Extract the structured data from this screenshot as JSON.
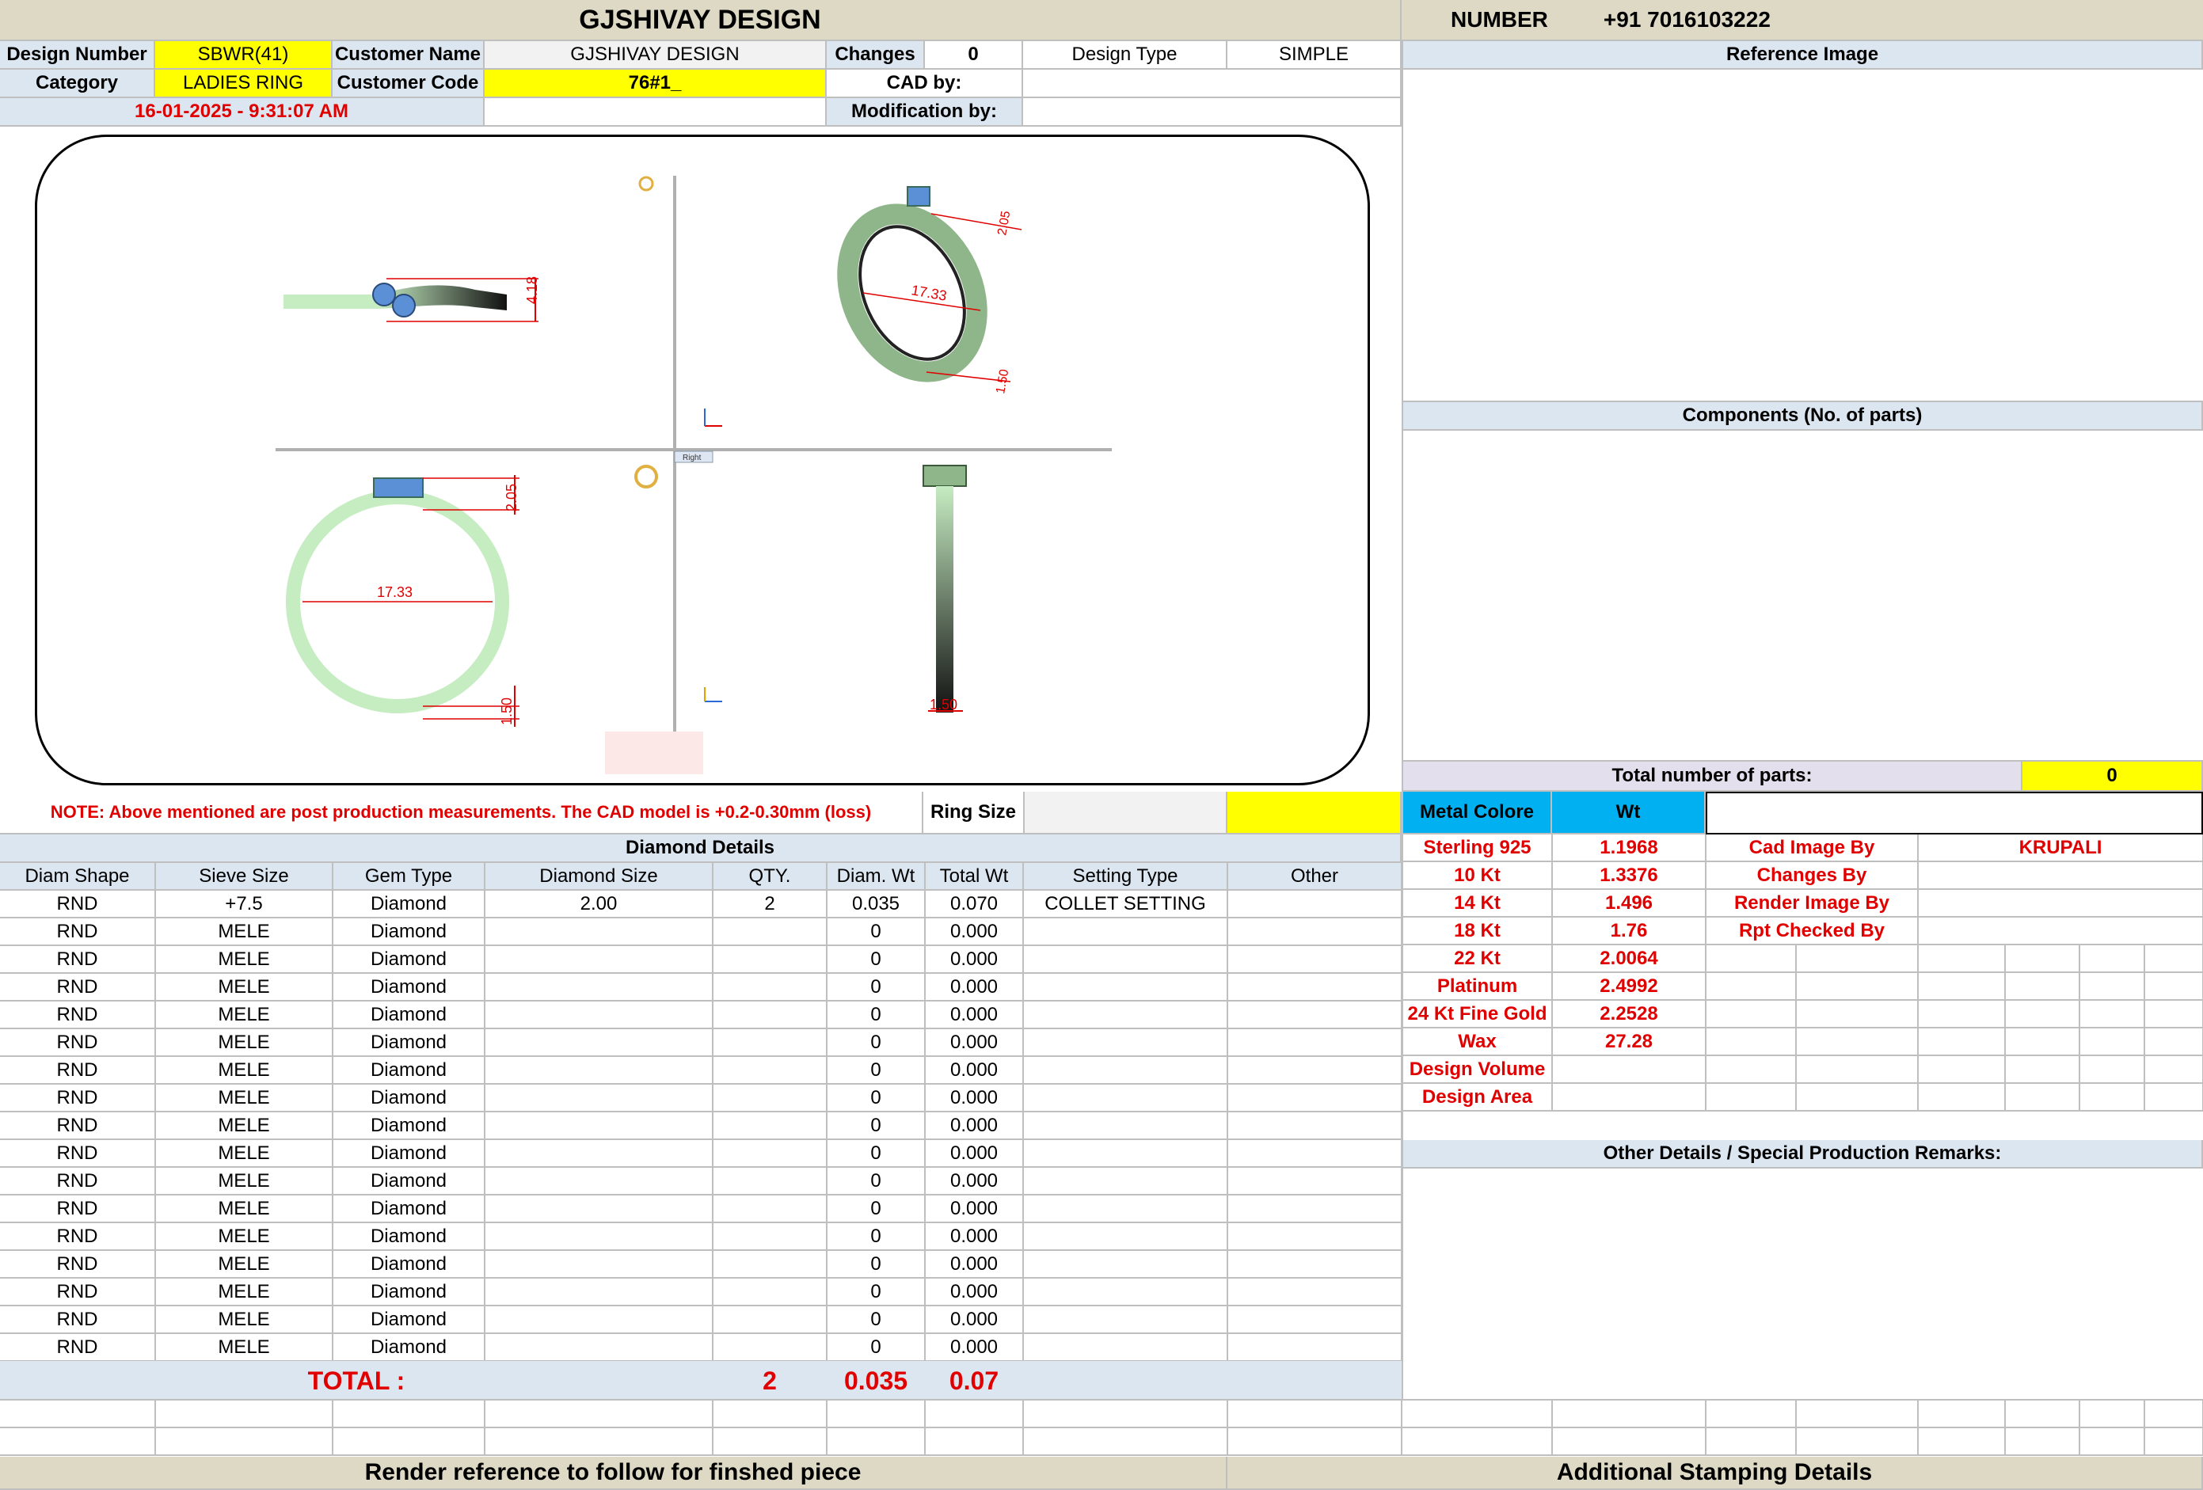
{
  "header": {
    "title": "GJSHIVAY DESIGN",
    "number_label": "NUMBER",
    "number_value": "+91 7016103222"
  },
  "info": {
    "design_number_label": "Design Number",
    "design_number": "SBWR(41)",
    "customer_name_label": "Customer Name",
    "customer_name": "GJSHIVAY DESIGN",
    "changes_label": "Changes",
    "changes": "0",
    "design_type_label": "Design Type",
    "design_type": "SIMPLE",
    "category_label": "Category",
    "category": "LADIES RING",
    "customer_code_label": "Customer Code",
    "customer_code": "76#1_",
    "cad_by_label": "CAD by:",
    "cad_by": "",
    "timestamp": "16-01-2025 - 9:31:07 AM",
    "modification_by_label": "Modification by:",
    "modification_by": ""
  },
  "drawing": {
    "dim_side_height": "4.18",
    "dim_top_inner": "17.33",
    "dim_top_band": "2.05",
    "dim_top_base": "1.50",
    "dim_front_inner": "17.33",
    "dim_front_top": "2.05",
    "dim_front_bottom": "1.50",
    "dim_side_bottom": "1.50",
    "viewport_label": "Right",
    "colors": {
      "metal": "#c6ecc2",
      "metal_dark": "#7fa87a",
      "stone": "#5b8fd6",
      "dim": "#e00000"
    }
  },
  "note": {
    "text": "NOTE: Above mentioned are post production measurements. The CAD model is +0.2-0.30mm (loss)",
    "ring_size_label": "Ring Size",
    "ring_size": ""
  },
  "diamond": {
    "title": "Diamond Details",
    "columns": [
      "Diam Shape",
      "Sieve Size",
      "Gem Type",
      "Diamond Size",
      "QTY.",
      "Diam. Wt",
      "Total Wt",
      "Setting Type",
      "Other"
    ],
    "rows": [
      [
        "RND",
        "+7.5",
        "Diamond",
        "2.00",
        "2",
        "0.035",
        "0.070",
        "COLLET SETTING",
        ""
      ],
      [
        "RND",
        "MELE",
        "Diamond",
        "",
        "",
        "0",
        "0.000",
        "",
        ""
      ],
      [
        "RND",
        "MELE",
        "Diamond",
        "",
        "",
        "0",
        "0.000",
        "",
        ""
      ],
      [
        "RND",
        "MELE",
        "Diamond",
        "",
        "",
        "0",
        "0.000",
        "",
        ""
      ],
      [
        "RND",
        "MELE",
        "Diamond",
        "",
        "",
        "0",
        "0.000",
        "",
        ""
      ],
      [
        "RND",
        "MELE",
        "Diamond",
        "",
        "",
        "0",
        "0.000",
        "",
        ""
      ],
      [
        "RND",
        "MELE",
        "Diamond",
        "",
        "",
        "0",
        "0.000",
        "",
        ""
      ],
      [
        "RND",
        "MELE",
        "Diamond",
        "",
        "",
        "0",
        "0.000",
        "",
        ""
      ],
      [
        "RND",
        "MELE",
        "Diamond",
        "",
        "",
        "0",
        "0.000",
        "",
        ""
      ],
      [
        "RND",
        "MELE",
        "Diamond",
        "",
        "",
        "0",
        "0.000",
        "",
        ""
      ],
      [
        "RND",
        "MELE",
        "Diamond",
        "",
        "",
        "0",
        "0.000",
        "",
        ""
      ],
      [
        "RND",
        "MELE",
        "Diamond",
        "",
        "",
        "0",
        "0.000",
        "",
        ""
      ],
      [
        "RND",
        "MELE",
        "Diamond",
        "",
        "",
        "0",
        "0.000",
        "",
        ""
      ],
      [
        "RND",
        "MELE",
        "Diamond",
        "",
        "",
        "0",
        "0.000",
        "",
        ""
      ],
      [
        "RND",
        "MELE",
        "Diamond",
        "",
        "",
        "0",
        "0.000",
        "",
        ""
      ],
      [
        "RND",
        "MELE",
        "Diamond",
        "",
        "",
        "0",
        "0.000",
        "",
        ""
      ],
      [
        "RND",
        "MELE",
        "Diamond",
        "",
        "",
        "0",
        "0.000",
        "",
        ""
      ]
    ],
    "total_label": "TOTAL :",
    "total_qty": "2",
    "total_diam_wt": "0.035",
    "total_wt": "0.07"
  },
  "right": {
    "reference_image": "Reference Image",
    "components": "Components (No. of parts)",
    "total_parts_label": "Total number of parts:",
    "total_parts": "0",
    "metal_colore": "Metal Colore",
    "wt": "Wt",
    "metals": [
      {
        "name": "Sterling 925",
        "wt": "1.1968",
        "role": "Cad Image By",
        "person": "KRUPALI"
      },
      {
        "name": "10 Kt",
        "wt": "1.3376",
        "role": "Changes By",
        "person": ""
      },
      {
        "name": "14 Kt",
        "wt": "1.496",
        "role": "Render Image By",
        "person": ""
      },
      {
        "name": "18 Kt",
        "wt": "1.76",
        "role": "Rpt Checked By",
        "person": ""
      },
      {
        "name": "22 Kt",
        "wt": "2.0064"
      },
      {
        "name": "Platinum",
        "wt": "2.4992"
      },
      {
        "name": "24 Kt Fine Gold",
        "wt": "2.2528"
      },
      {
        "name": "Wax",
        "wt": "27.28"
      },
      {
        "name": "Design Volume",
        "wt": ""
      },
      {
        "name": "Design Area",
        "wt": ""
      }
    ],
    "other_details": "Other Details / Special Production Remarks:"
  },
  "footer": {
    "render_ref": "Render reference to follow for finshed piece",
    "stamping": "Additional Stamping Details"
  }
}
